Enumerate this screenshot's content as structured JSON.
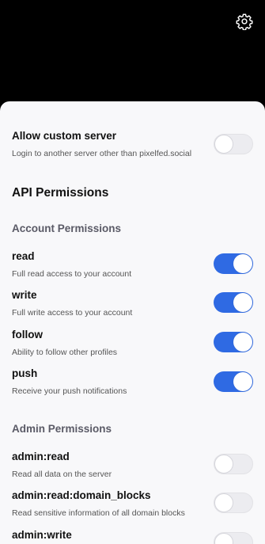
{
  "custom_server": {
    "title": "Allow custom server",
    "description": "Login to another server other than pixelfed.social",
    "enabled": false
  },
  "api_permissions": {
    "heading": "API Permissions"
  },
  "account_permissions": {
    "heading": "Account Permissions",
    "items": [
      {
        "title": "read",
        "description": "Full read access to your account",
        "enabled": true
      },
      {
        "title": "write",
        "description": "Full write access to your account",
        "enabled": true
      },
      {
        "title": "follow",
        "description": "Ability to follow other profiles",
        "enabled": true
      },
      {
        "title": "push",
        "description": "Receive your push notifications",
        "enabled": true
      }
    ]
  },
  "admin_permissions": {
    "heading": "Admin Permissions",
    "items": [
      {
        "title": "admin:read",
        "description": "Read all data on the server",
        "enabled": false
      },
      {
        "title": "admin:read:domain_blocks",
        "description": "Read sensitive information of all domain blocks",
        "enabled": false
      },
      {
        "title": "admin:write",
        "description": "",
        "enabled": false
      }
    ]
  },
  "colors": {
    "toggle_on": "#2f6ae3",
    "toggle_off": "#ececf0",
    "background": "#f8f8fa"
  },
  "icons": {
    "settings": "gear-icon"
  }
}
